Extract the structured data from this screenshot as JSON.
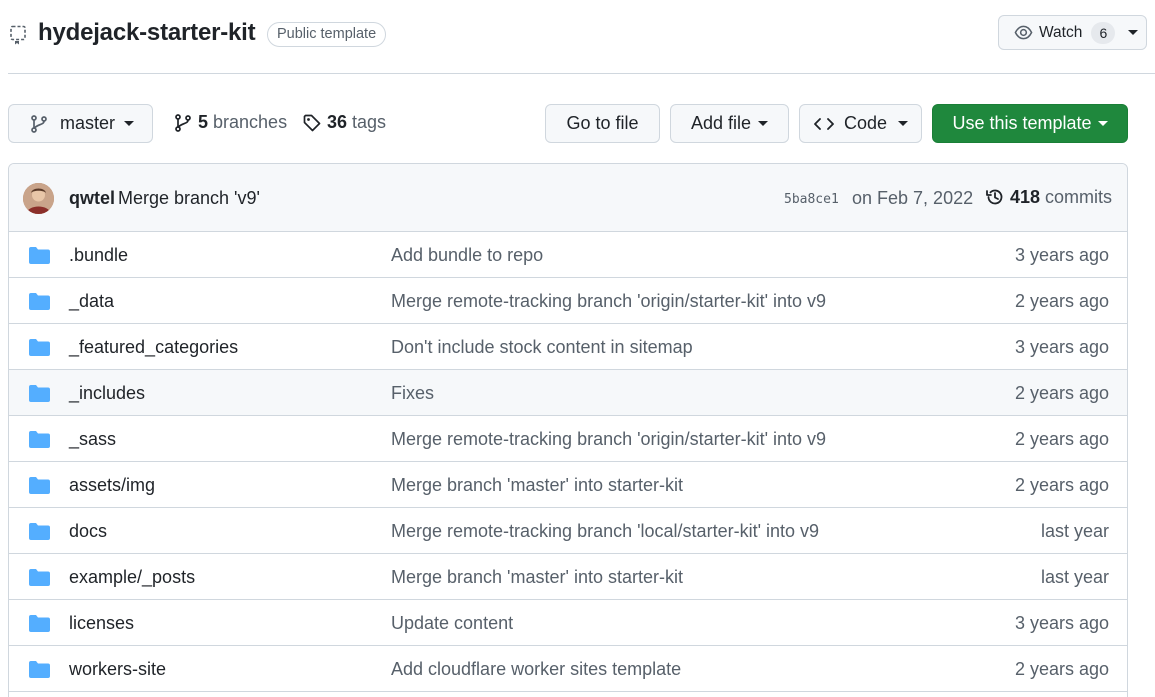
{
  "repo": {
    "name": "hydejack-starter-kit",
    "badge": "Public template"
  },
  "watch": {
    "label": "Watch",
    "count": "6"
  },
  "toolbar": {
    "branch": "master",
    "branches_count": "5",
    "branches_label": "branches",
    "tags_count": "36",
    "tags_label": "tags",
    "goto_label": "Go to file",
    "addfile_label": "Add file",
    "code_label": "Code",
    "template_label": "Use this template"
  },
  "commit": {
    "author": "qwtel",
    "message": "Merge branch 'v9'",
    "sha": "5ba8ce1",
    "date": "on Feb 7, 2022",
    "count": "418",
    "count_label": "commits"
  },
  "files": [
    {
      "name": ".bundle",
      "message": "Add bundle to repo",
      "age": "3 years ago"
    },
    {
      "name": "_data",
      "message": "Merge remote-tracking branch 'origin/starter-kit' into v9",
      "age": "2 years ago"
    },
    {
      "name": "_featured_categories",
      "message": "Don't include stock content in sitemap",
      "age": "3 years ago"
    },
    {
      "name": "_includes",
      "message": "Fixes",
      "age": "2 years ago"
    },
    {
      "name": "_sass",
      "message": "Merge remote-tracking branch 'origin/starter-kit' into v9",
      "age": "2 years ago"
    },
    {
      "name": "assets/img",
      "message": "Merge branch 'master' into starter-kit",
      "age": "2 years ago"
    },
    {
      "name": "docs",
      "message": "Merge remote-tracking branch 'local/starter-kit' into v9",
      "age": "last year"
    },
    {
      "name": "example/_posts",
      "message": "Merge branch 'master' into starter-kit",
      "age": "last year"
    },
    {
      "name": "licenses",
      "message": "Update content",
      "age": "3 years ago"
    },
    {
      "name": "workers-site",
      "message": "Add cloudflare worker sites template",
      "age": "2 years ago"
    }
  ],
  "colors": {
    "folder": "#54aeff",
    "primary": "#1f883d",
    "border": "#d0d7de",
    "muted": "#57606a"
  }
}
